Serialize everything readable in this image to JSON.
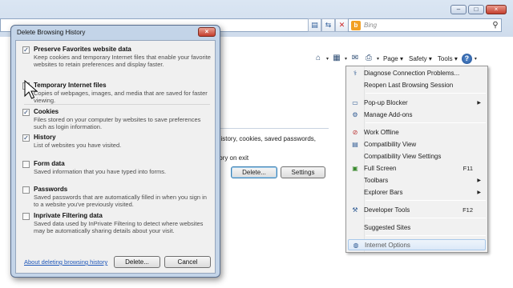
{
  "browser": {
    "search_placeholder": "Bing",
    "search_logo": "b",
    "window_controls": [
      "–",
      "□",
      "×"
    ],
    "address_icons": [
      "compat-view-icon",
      "refresh-icon",
      "stop-icon"
    ],
    "toolbar": {
      "page_label": "Page",
      "safety_label": "Safety",
      "tools_label": "Tools",
      "help_label": "?"
    }
  },
  "background_dialog": {
    "line1": "history, cookies, saved passwords,",
    "line2": "tory on exit",
    "delete_label": "Delete...",
    "settings_label": "Settings"
  },
  "tools_menu": {
    "items": [
      {
        "label": "Diagnose Connection Problems...",
        "icon": "diagnose-icon"
      },
      {
        "label": "Reopen Last Browsing Session",
        "icon": ""
      },
      {
        "label": "Pop-up Blocker",
        "icon": "popup-icon",
        "submenu": true
      },
      {
        "label": "Manage Add-ons",
        "icon": "addons-icon"
      },
      {
        "label": "Work Offline",
        "icon": "offline-icon"
      },
      {
        "label": "Compatibility View",
        "icon": "compat-icon"
      },
      {
        "label": "Compatibility View Settings",
        "icon": ""
      },
      {
        "label": "Full Screen",
        "icon": "fullscreen-icon",
        "shortcut": "F11"
      },
      {
        "label": "Toolbars",
        "icon": "",
        "submenu": true
      },
      {
        "label": "Explorer Bars",
        "icon": "",
        "submenu": true
      },
      {
        "label": "Developer Tools",
        "icon": "devtools-icon",
        "shortcut": "F12"
      },
      {
        "label": "Suggested Sites",
        "icon": ""
      },
      {
        "label": "Internet Options",
        "icon": "options-icon"
      }
    ]
  },
  "dialog": {
    "title": "Delete Browsing History",
    "close_label": "×",
    "options": [
      {
        "title": "Preserve Favorites website data",
        "desc": "Keep cookies and temporary Internet files that enable your favorite websites to retain preferences and display faster.",
        "checked": true
      },
      {
        "title": "Temporary Internet files",
        "desc": "Copies of webpages, images, and media that are saved for faster viewing.",
        "checked": true
      },
      {
        "title": "Cookies",
        "desc": "Files stored on your computer by websites to save preferences such as login information.",
        "checked": true
      },
      {
        "title": "History",
        "desc": "List of websites you have visited.",
        "checked": true
      },
      {
        "title": "Form data",
        "desc": "Saved information that you have typed into forms.",
        "checked": false
      },
      {
        "title": "Passwords",
        "desc": "Saved passwords that are automatically filled in when you sign in to a website you've previously visited.",
        "checked": false
      },
      {
        "title": "Inprivate Filtering data",
        "desc": "Saved data used by InPrivate Filtering to detect where websites may be automatically sharing details about your visit.",
        "checked": false
      }
    ],
    "about_link": "About deleting browsing history",
    "delete_label": "Delete...",
    "cancel_label": "Cancel"
  }
}
